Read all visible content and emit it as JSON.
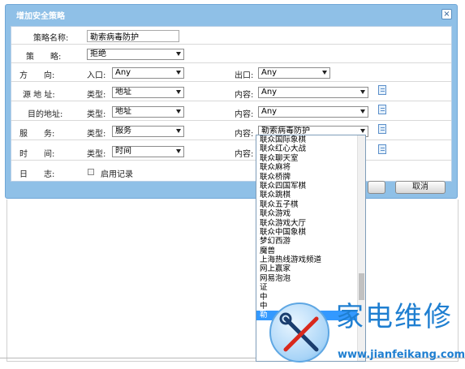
{
  "dialog": {
    "title": "增加安全策略",
    "close_label": "×"
  },
  "form": {
    "name_label": "策略名称:",
    "name_value": "勒索病毒防护",
    "policy_label": "策　　略:",
    "policy_value": "拒绝",
    "direction_label": "方　　向:",
    "inbound_label": "入口:",
    "inbound_value": "Any",
    "outbound_label": "出口:",
    "outbound_value": "Any",
    "src_label": "源 地 址:",
    "src_type_label": "类型:",
    "src_type_value": "地址",
    "src_content_label": "内容:",
    "src_content_value": "Any",
    "dst_label": "目的地址:",
    "dst_type_label": "类型:",
    "dst_type_value": "地址",
    "dst_content_label": "内容:",
    "dst_content_value": "Any",
    "service_label": "服　　务:",
    "service_type_label": "类型:",
    "service_type_value": "服务",
    "service_content_label": "内容:",
    "service_content_value": "勒索病毒防护",
    "time_label": "时　　间:",
    "time_type_label": "类型:",
    "time_type_value": "时间",
    "time_content_label": "内容:",
    "log_label": "日　　志:",
    "log_checkbox_label": "启用记录"
  },
  "buttons": {
    "cancel": "取消"
  },
  "dropdown_items": [
    "联众国际象棋",
    "联众红心大战",
    "联众聊天室",
    "联众麻将",
    "联众桥牌",
    "联众四国军棋",
    "联众跳棋",
    "联众五子棋",
    "联众游戏",
    "联众游戏大厅",
    "联众中国象棋",
    "梦幻西游",
    "魔兽",
    "上海热线游戏频道",
    "网上赢家",
    "网易泡泡",
    "证",
    "中",
    "中",
    "勒"
  ],
  "watermark": {
    "title": "家电维修",
    "url": "www.jianfeikang.com"
  }
}
